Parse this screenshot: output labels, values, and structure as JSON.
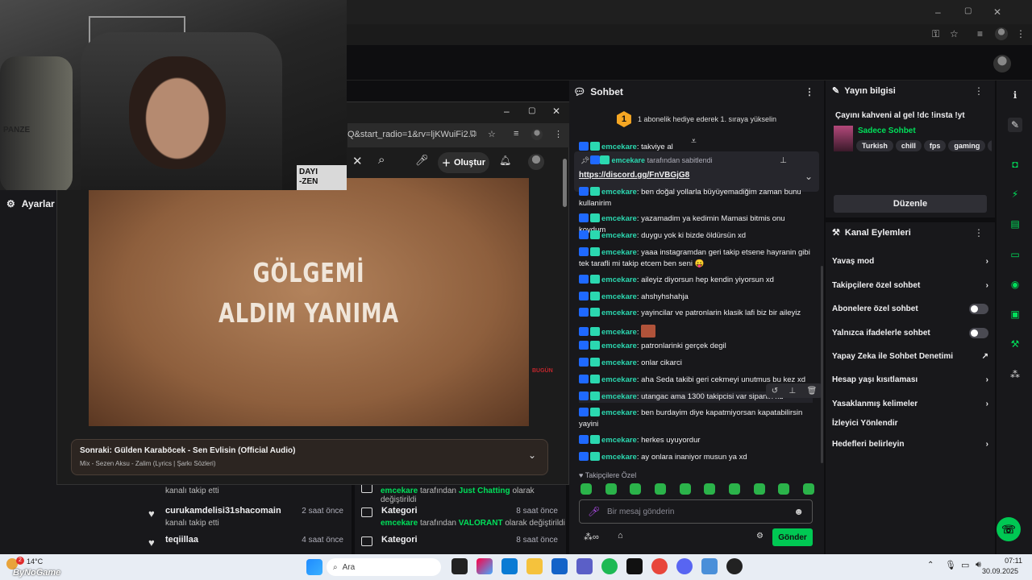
{
  "browser": {
    "topbar_buttons": [
      "–",
      "▢",
      "✕"
    ],
    "site_avatar": "avatar"
  },
  "left": {
    "settings_label": "Ayarlar",
    "activity": [
      {
        "title": "",
        "subtitle": "kanalı takip etti",
        "time": ""
      },
      {
        "title": "curukamdelisi31shacomain",
        "subtitle": "kanalı takip etti",
        "time": "2 saat önce"
      },
      {
        "title": "teqiillaa",
        "subtitle": "",
        "time": "4 saat önce"
      }
    ],
    "categories": [
      {
        "title": "",
        "actor": "emcekare",
        "middle": "tarafından",
        "value": "Just Chatting",
        "suffix": "olarak değiştirildi",
        "time": ""
      },
      {
        "title": "Kategori",
        "actor": "emcekare",
        "middle": "tarafından",
        "value": "VALORANT",
        "suffix": "olarak değiştirildi",
        "time": "8 saat önce"
      },
      {
        "title": "Kategori",
        "actor": "",
        "middle": "",
        "value": "",
        "suffix": "",
        "time": "8 saat önce"
      }
    ]
  },
  "youtube": {
    "url": "Q&start_radio=1&rv=ljKWuiFi2...",
    "create_label": "Oluştur",
    "lyrics": [
      "GÖLGEMİ",
      "ALDIM YANIMA"
    ],
    "watermark": "BUGÜN",
    "next_title": "Sonraki: Gülden Karaböcek - Sen Evlisin (Official Audio)",
    "next_subtitle": "Mix - Sezen Aksu - Zalim (Lyrics | Şarkı Sözleri)"
  },
  "chat": {
    "header": "Sohbet",
    "gift_badge": "1",
    "gift_text": "1 abonelik hediye ederek 1. sıraya yükselin",
    "pinned_user": "emcekare",
    "pinned_by": "tarafından sabitlendi",
    "pinned_link": "https://discord.gg/FnVBGjG8",
    "messages": [
      {
        "user": "emcekare",
        "text": "takviye al"
      },
      {
        "user": "emcekare",
        "text": "ben doğal yollarla büyüyemadiğim zaman bunu kullanirim"
      },
      {
        "user": "emcekare",
        "text": "yazamadim ya kedimin Mamasi bitmis onu koydum"
      },
      {
        "user": "emcekare",
        "text": "duygu yok ki bizde öldürsün xd"
      },
      {
        "user": "emcekare",
        "text": "yaaa instagramdan geri takip etsene hayranin gibi tek tarafli mi takip etcem ben seni 😛"
      },
      {
        "user": "emcekare",
        "text": "aileyiz diyorsun hep kendin yiyorsun xd"
      },
      {
        "user": "emcekare",
        "text": "ahshyhshahja"
      },
      {
        "user": "emcekare",
        "text": "yayincilar ve patronlarin klasik lafi biz bir aileyiz"
      },
      {
        "user": "emcekare",
        "text": ""
      },
      {
        "user": "emcekare",
        "text": "patronlarinki gerçek degil"
      },
      {
        "user": "emcekare",
        "text": "onlar cikarci"
      },
      {
        "user": "emcekare",
        "text": "aha Seda takibi geri cekmeyi unutmus bu kez xd"
      },
      {
        "user": "emcekare",
        "text": "utangac ama 1300 takipcisi var sipanin xd"
      },
      {
        "user": "emcekare",
        "text": "ben burdayim diye kapatmiyorsan kapatabilirsin yayini"
      },
      {
        "user": "emcekare",
        "text": "herkes uyuyordur"
      },
      {
        "user": "emcekare",
        "text": "ay onlara inaniyor musun ya xd"
      }
    ],
    "sub_only_label": "Takipçilere Özel",
    "input_placeholder": "Bir mesaj gönderin",
    "send_label": "Gönder"
  },
  "stream_info": {
    "header": "Yayın bilgisi",
    "title": "Çayını kahveni al gel !dc !insta !yt",
    "category": "Sadece Sohbet",
    "tags": [
      "Turkish",
      "chill",
      "fps",
      "gaming",
      "va"
    ],
    "edit_label": "Düzenle"
  },
  "channel_actions": {
    "header": "Kanal Eylemleri",
    "items": [
      {
        "label": "Yavaş mod",
        "control": "chevron"
      },
      {
        "label": "Takipçilere özel sohbet",
        "control": "chevron"
      },
      {
        "label": "Abonelere özel sohbet",
        "control": "toggle"
      },
      {
        "label": "Yalnızca ifadelerle sohbet",
        "control": "toggle"
      },
      {
        "label": "Yapay Zeka ile Sohbet Denetimi",
        "control": "external"
      },
      {
        "label": "Hesap yaşı kısıtlaması",
        "control": "chevron"
      },
      {
        "label": "Yasaklanmış kelimeler",
        "control": "chevron"
      },
      {
        "label": "İzleyici Yönlendir",
        "control": "none"
      },
      {
        "label": "Hedefleri belirleyin",
        "control": "chevron"
      }
    ]
  },
  "webcam": {
    "sign_lines": [
      "DAYI",
      "-ZEN"
    ],
    "chair_label": "PANZE"
  },
  "taskbar": {
    "weather_temp": "14°C",
    "weather_badge": "2",
    "overlay_text": "ByNoGame",
    "search_placeholder": "Ara",
    "time": "07:11",
    "date": "30.09.2025"
  },
  "colors": {
    "accent_green": "#00c853",
    "chat_user": "#2bd8b0",
    "badge_blue": "#1f69ff",
    "gift_badge": "#f5a623"
  }
}
